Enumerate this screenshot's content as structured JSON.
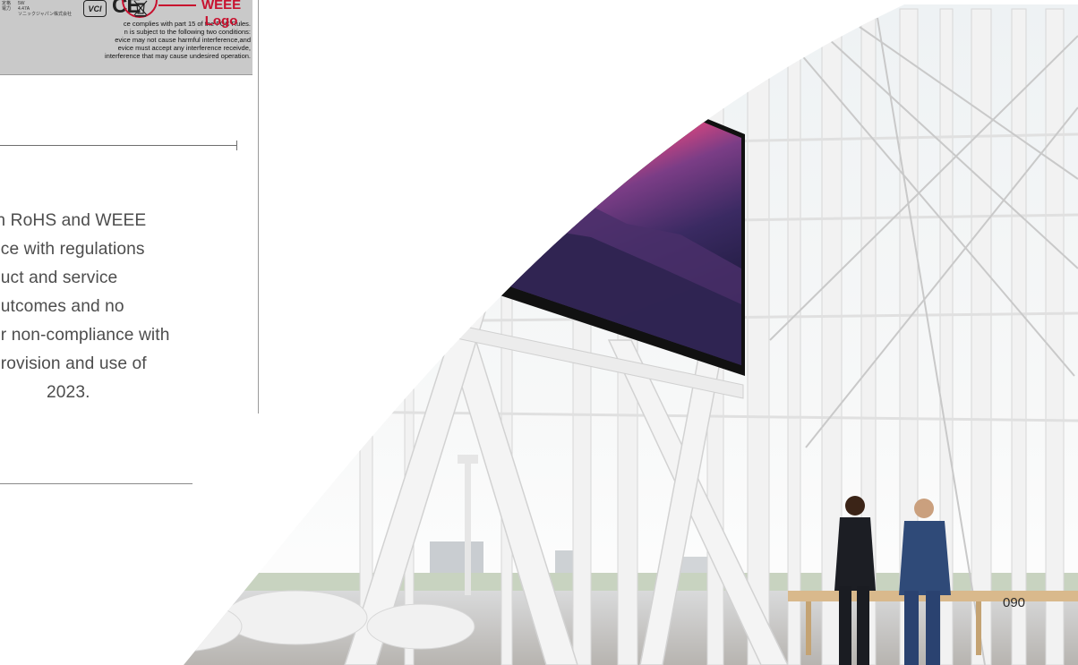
{
  "label": {
    "tiny_rows": [
      "定格",
      "5W",
      "電力",
      "4.47A",
      "",
      "ソニックジャパン株式会社"
    ],
    "fcc_lines": [
      "ce complies with part 15 of the FCC Rules.",
      "n is subject to the following two conditions:",
      "evice may not cause harmful interference,and",
      "evice must accept any interference receivde,",
      "interference that may cause undesired operation."
    ],
    "vci_mark": "VCI",
    "ce_mark": "CE",
    "weee_icon": "crossed-bin-icon",
    "weee_label_line1": "WEEE",
    "weee_label_line2": "Logo",
    "accent_color": "#c8102e"
  },
  "body": {
    "lines": [
      "th RoHS and WEEE",
      "nce with regulations",
      "duct and service",
      "outcomes and no",
      "or non-compliance with",
      "provision and use of",
      "2023."
    ]
  },
  "page_number": "090"
}
